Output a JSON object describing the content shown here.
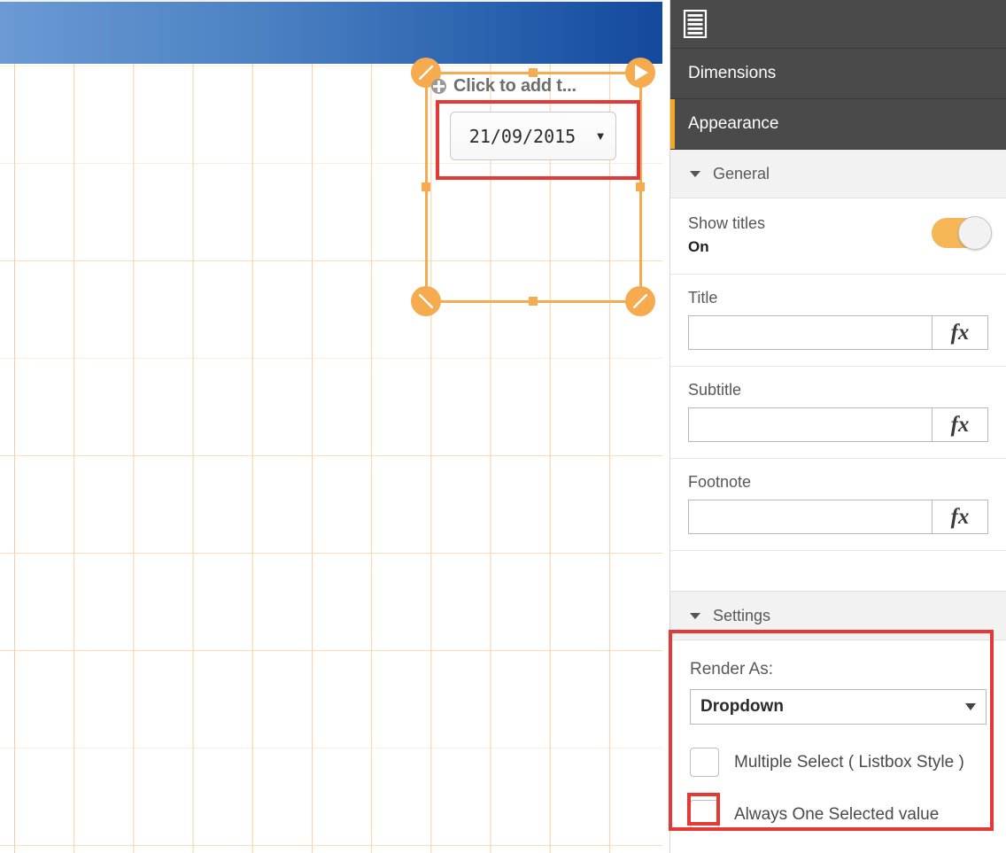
{
  "canvas": {
    "object_title": "Click to add t...",
    "drag_icon": "move-crosshair-icon",
    "dropdown_value": "21/09/2015",
    "dropdown_caret": "▼",
    "handles": {
      "top_left": "resize-nwse-handle",
      "top_right": "resize-nesw-handle",
      "bottom_left": "resize-nesw-handle",
      "bottom_right": "resize-nwse-handle"
    }
  },
  "panel": {
    "toolbar_icon": "list-properties-icon",
    "tabs": [
      {
        "label": "Dimensions",
        "active": false
      },
      {
        "label": "Appearance",
        "active": true
      }
    ],
    "general": {
      "header": "General",
      "caret": "▼",
      "show_titles_label": "Show titles",
      "show_titles_state": "On",
      "show_titles_on": true,
      "fields": [
        {
          "label": "Title",
          "value": "",
          "placeholder": "",
          "fx": "fx"
        },
        {
          "label": "Subtitle",
          "value": "",
          "placeholder": "",
          "fx": "fx"
        },
        {
          "label": "Footnote",
          "value": "",
          "placeholder": "",
          "fx": "fx"
        }
      ]
    },
    "settings": {
      "header": "Settings",
      "caret": "▼",
      "render_as_label": "Render As:",
      "render_as_value": "Dropdown",
      "render_as_caret": "▼",
      "checkboxes": [
        {
          "label": "Multiple Select ( Listbox Style )",
          "checked": false
        },
        {
          "label": "Always One Selected value",
          "checked": false
        }
      ]
    }
  },
  "colors": {
    "accent_orange": "#f5a623",
    "handle_orange": "#f5ab4e",
    "annotation_red": "#e53935",
    "panel_dark": "#4a4a4a",
    "header_blue_light": "#6b9ad4",
    "header_blue_dark": "#14499c"
  }
}
